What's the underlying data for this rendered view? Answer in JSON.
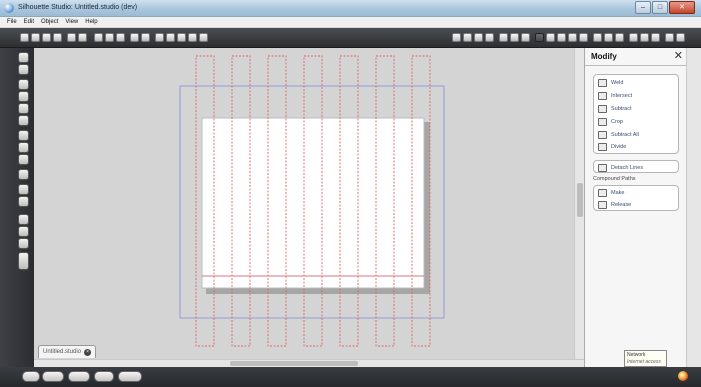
{
  "window": {
    "title": "Silhouette Studio: Untitled.studio (dev)",
    "controls": {
      "minimize": "–",
      "maximize": "□",
      "close": "✕"
    }
  },
  "menu": [
    "File",
    "Edit",
    "Object",
    "View",
    "Help"
  ],
  "document_tab": {
    "label": "Untitled.studio",
    "close": "×"
  },
  "modify_panel": {
    "title": "Modify",
    "close": "✕",
    "boolean_ops": [
      {
        "label": "Weld",
        "icon": "weld-icon"
      },
      {
        "label": "Intersect",
        "icon": "intersect-icon"
      },
      {
        "label": "Subtract",
        "icon": "subtract-icon"
      },
      {
        "label": "Crop",
        "icon": "crop-icon"
      },
      {
        "label": "Subtract All",
        "icon": "subtract-all-icon"
      },
      {
        "label": "Divide",
        "icon": "divide-icon"
      }
    ],
    "detach_lines": "Detach Lines",
    "compound_paths_label": "Compound Paths",
    "compound_ops": [
      {
        "label": "Make",
        "icon": "make-compound-icon"
      },
      {
        "label": "Release",
        "icon": "release-compound-icon"
      }
    ]
  },
  "tooltip": {
    "line1": "Network",
    "line2": "Internet access"
  },
  "colors": {
    "cut_line": "#e06666",
    "page_outline": "#8f9bd6",
    "canvas": "#d4d4d4",
    "toolbar": "#34373b"
  },
  "canvas_content": {
    "strips": 7,
    "page": "white cutting mat with vertical dashed cut lines"
  }
}
